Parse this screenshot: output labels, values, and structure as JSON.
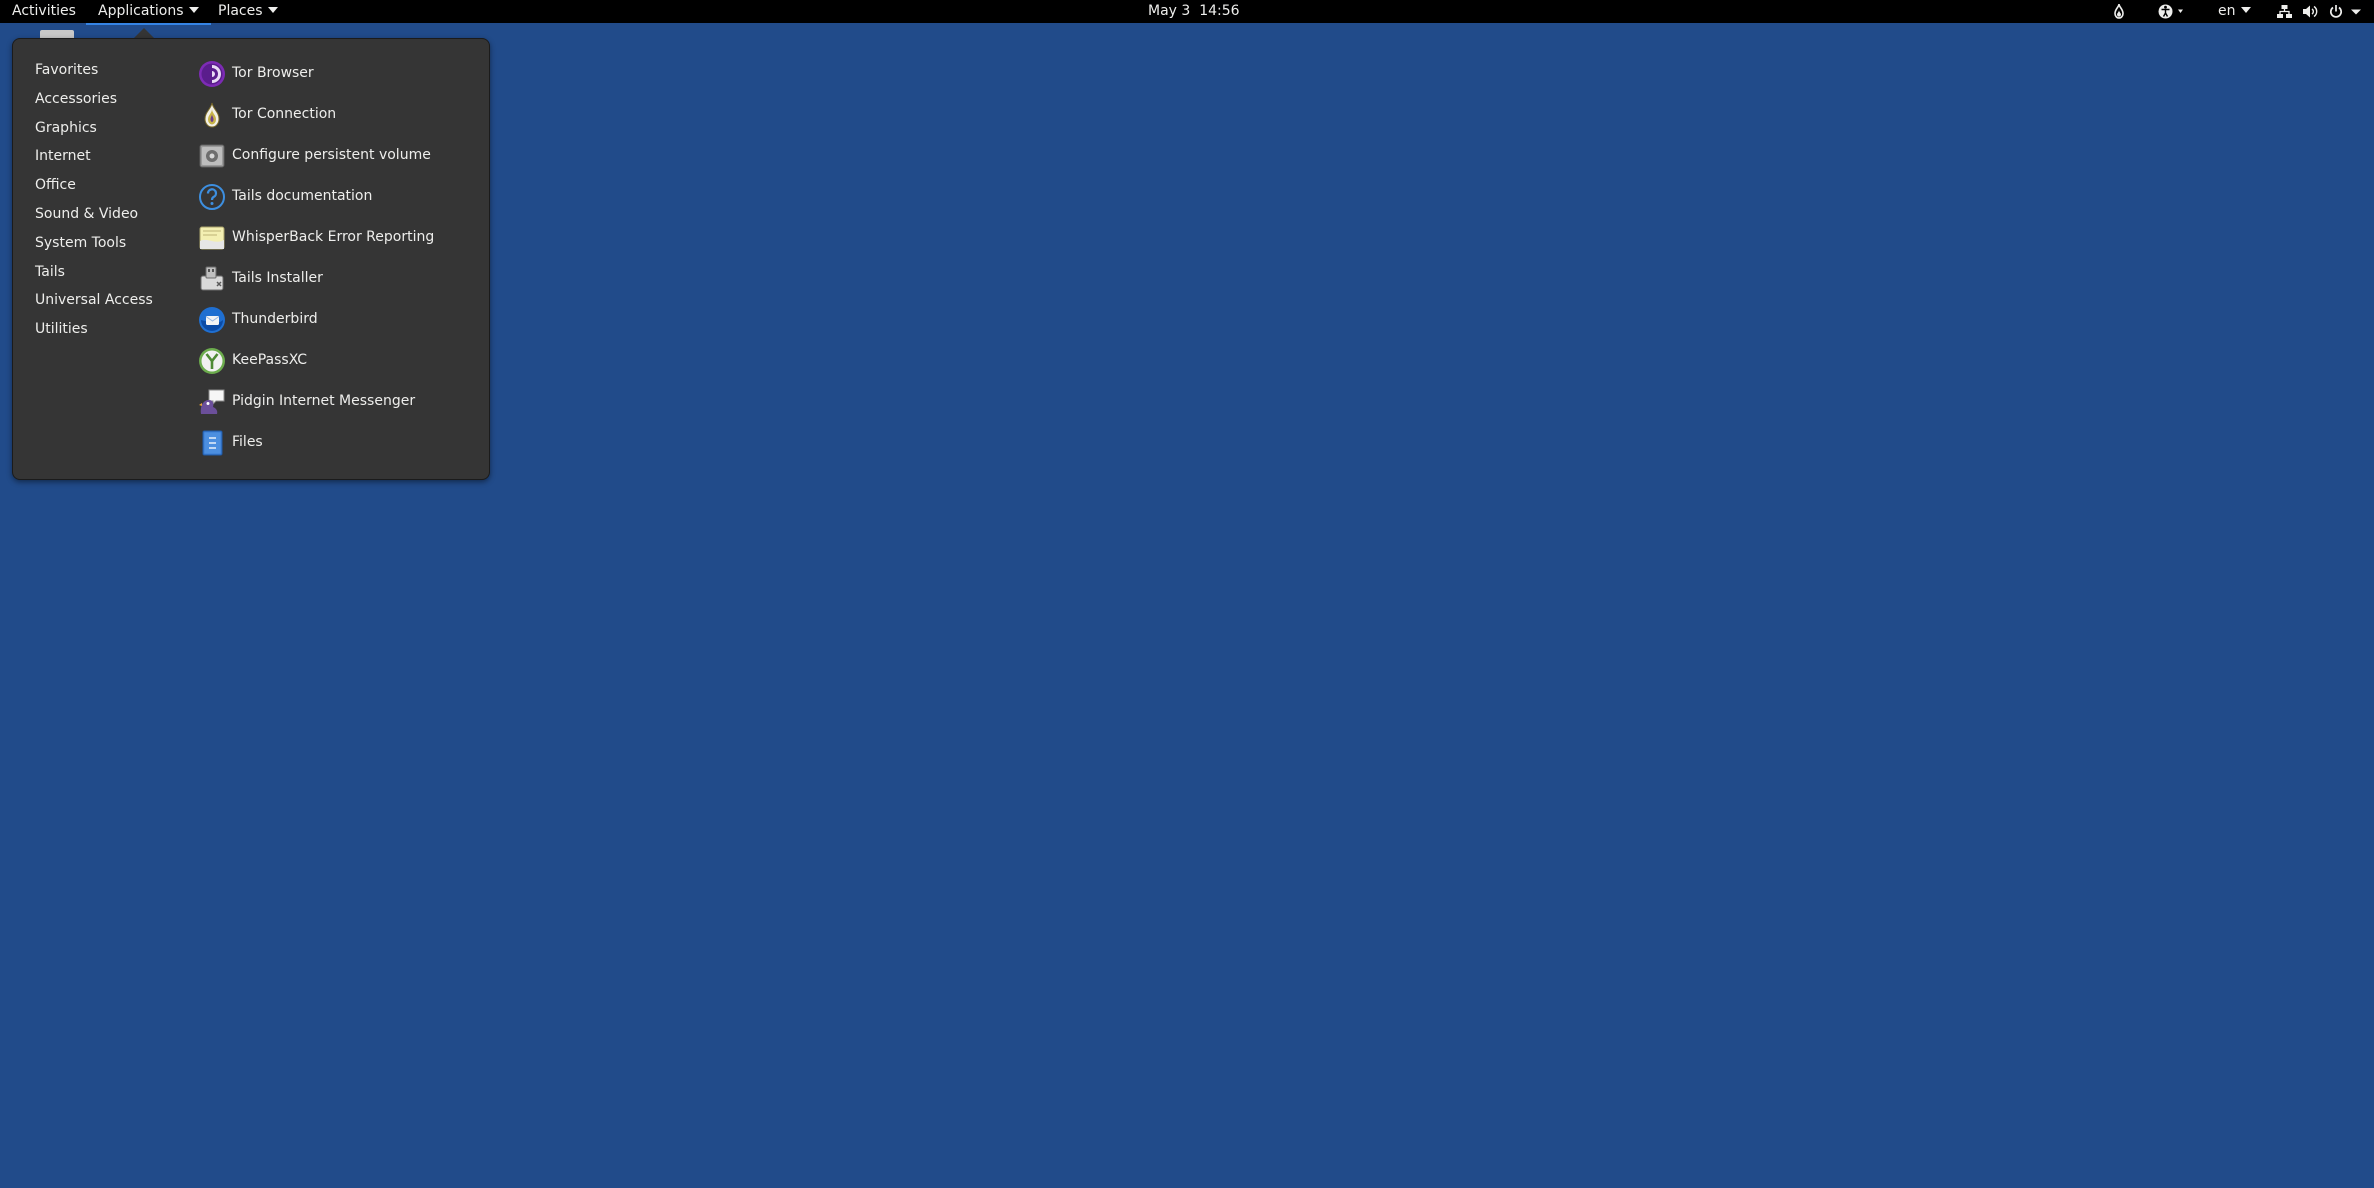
{
  "topbar": {
    "activities": "Activities",
    "applications": "Applications",
    "places": "Places",
    "clock": "May 3  14:56",
    "keyboard_layout": "en",
    "tray_icons": [
      "tor-status-icon",
      "accessibility-icon",
      "network-icon",
      "volume-icon",
      "power-icon"
    ]
  },
  "menu": {
    "categories": [
      {
        "label": "Favorites"
      },
      {
        "label": "Accessories"
      },
      {
        "label": "Graphics"
      },
      {
        "label": "Internet"
      },
      {
        "label": "Office"
      },
      {
        "label": "Sound & Video"
      },
      {
        "label": "System Tools"
      },
      {
        "label": "Tails"
      },
      {
        "label": "Universal Access"
      },
      {
        "label": "Utilities"
      }
    ],
    "apps": [
      {
        "label": "Tor Browser",
        "icon": "tor-browser-icon"
      },
      {
        "label": "Tor Connection",
        "icon": "tor-connection-icon"
      },
      {
        "label": "Configure persistent volume",
        "icon": "persistent-volume-icon"
      },
      {
        "label": "Tails documentation",
        "icon": "help-icon"
      },
      {
        "label": "WhisperBack Error Reporting",
        "icon": "whisperback-icon"
      },
      {
        "label": "Tails Installer",
        "icon": "tails-installer-icon"
      },
      {
        "label": "Thunderbird",
        "icon": "thunderbird-icon"
      },
      {
        "label": "KeePassXC",
        "icon": "keepassxc-icon"
      },
      {
        "label": "Pidgin Internet Messenger",
        "icon": "pidgin-icon"
      },
      {
        "label": "Files",
        "icon": "files-icon"
      }
    ]
  },
  "colors": {
    "desktop_background": "#214b8a",
    "panel": "#000000",
    "popup_background": "#353535",
    "accent": "#3584e4"
  }
}
